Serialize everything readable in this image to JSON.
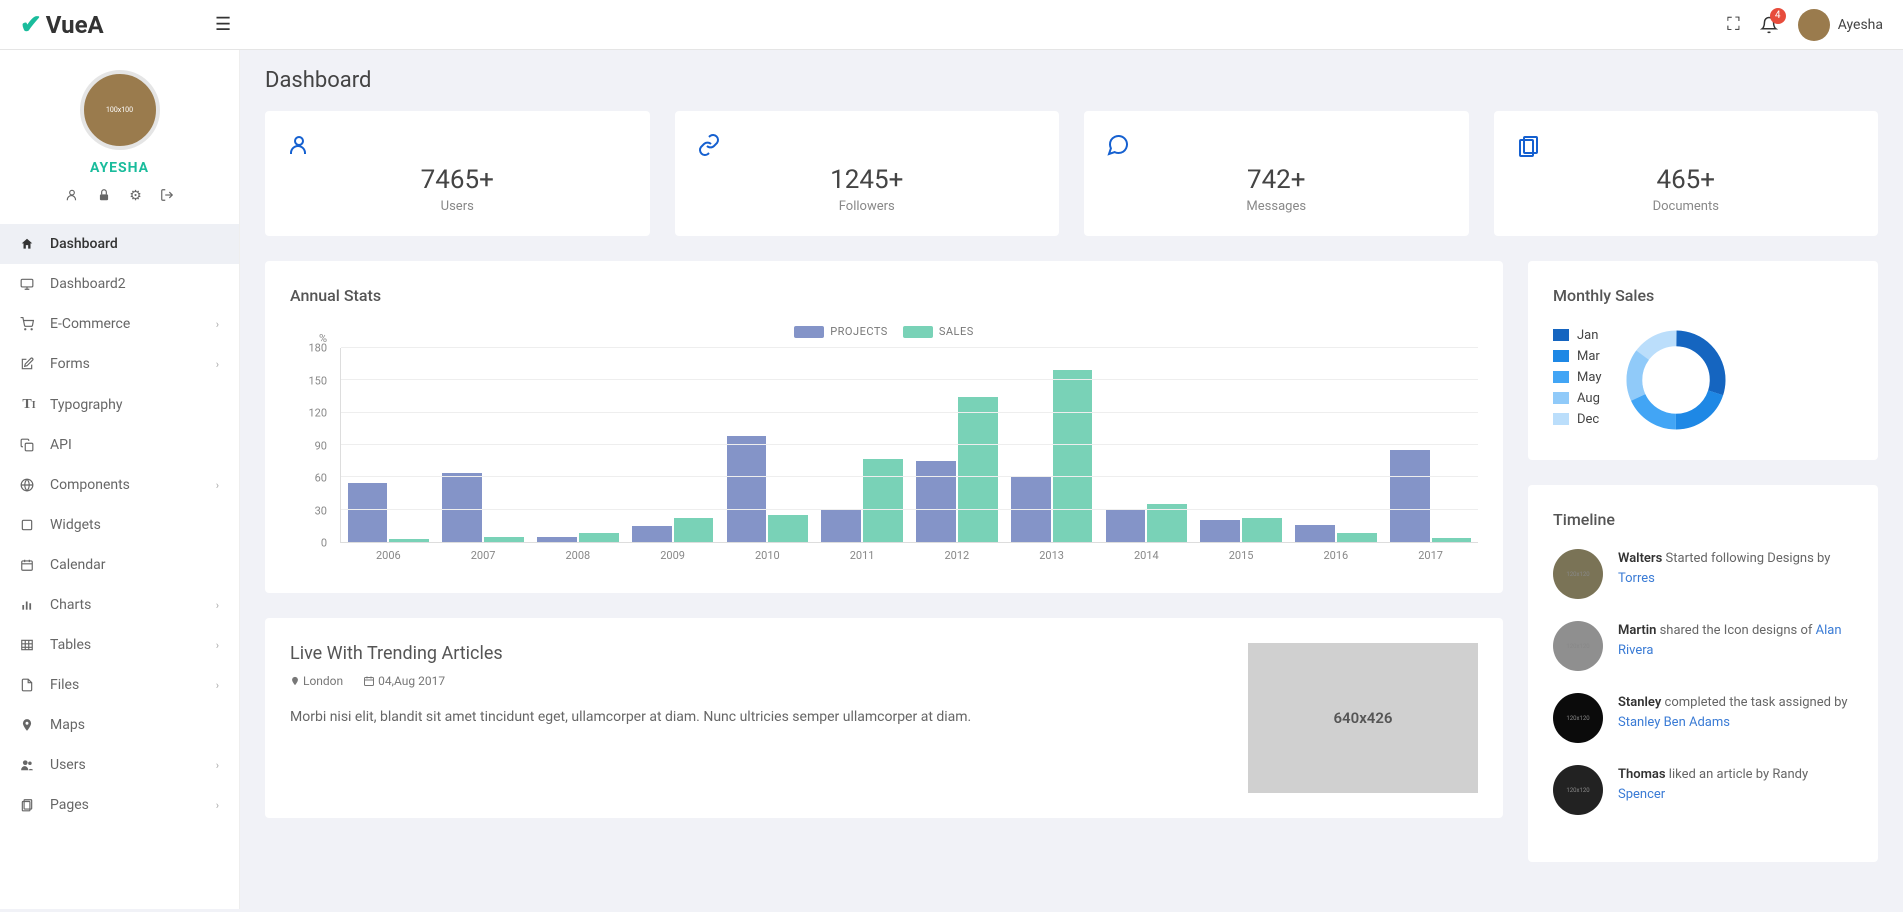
{
  "header": {
    "logo_text": "VueA",
    "notification_count": "4",
    "username": "Ayesha"
  },
  "sidebar": {
    "profile_name": "AYESHA",
    "items": [
      {
        "label": "Dashboard",
        "icon": "home",
        "active": true,
        "expandable": false
      },
      {
        "label": "Dashboard2",
        "icon": "desktop",
        "active": false,
        "expandable": false
      },
      {
        "label": "E-Commerce",
        "icon": "cart",
        "active": false,
        "expandable": true
      },
      {
        "label": "Forms",
        "icon": "edit",
        "active": false,
        "expandable": true
      },
      {
        "label": "Typography",
        "icon": "text",
        "active": false,
        "expandable": false
      },
      {
        "label": "API",
        "icon": "copy",
        "active": false,
        "expandable": false
      },
      {
        "label": "Components",
        "icon": "globe",
        "active": false,
        "expandable": true
      },
      {
        "label": "Widgets",
        "icon": "square",
        "active": false,
        "expandable": false
      },
      {
        "label": "Calendar",
        "icon": "calendar",
        "active": false,
        "expandable": false
      },
      {
        "label": "Charts",
        "icon": "chart",
        "active": false,
        "expandable": true
      },
      {
        "label": "Tables",
        "icon": "table",
        "active": false,
        "expandable": true
      },
      {
        "label": "Files",
        "icon": "file",
        "active": false,
        "expandable": true
      },
      {
        "label": "Maps",
        "icon": "pin",
        "active": false,
        "expandable": false
      },
      {
        "label": "Users",
        "icon": "users",
        "active": false,
        "expandable": true
      },
      {
        "label": "Pages",
        "icon": "pages",
        "active": false,
        "expandable": true
      }
    ]
  },
  "page": {
    "title": "Dashboard"
  },
  "stats": [
    {
      "value": "7465+",
      "label": "Users",
      "icon": "user"
    },
    {
      "value": "1245+",
      "label": "Followers",
      "icon": "link"
    },
    {
      "value": "742+",
      "label": "Messages",
      "icon": "chat"
    },
    {
      "value": "465+",
      "label": "Documents",
      "icon": "docs"
    }
  ],
  "annual_stats_title": "Annual Stats",
  "chart_data": {
    "type": "bar",
    "title": "Annual Stats",
    "ylabel": "%",
    "ylim": [
      0,
      180
    ],
    "y_ticks": [
      0,
      30,
      60,
      90,
      120,
      150,
      180
    ],
    "categories": [
      "2006",
      "2007",
      "2008",
      "2009",
      "2010",
      "2011",
      "2012",
      "2013",
      "2014",
      "2015",
      "2016",
      "2017"
    ],
    "series": [
      {
        "name": "PROJECTS",
        "color": "#8494c8",
        "values": [
          55,
          64,
          5,
          15,
          98,
          30,
          75,
          60,
          30,
          20,
          16,
          85
        ]
      },
      {
        "name": "SALES",
        "color": "#79d2b7",
        "values": [
          3,
          5,
          8,
          22,
          25,
          77,
          135,
          160,
          35,
          22,
          8,
          4
        ]
      }
    ]
  },
  "monthly_sales": {
    "title": "Monthly Sales",
    "legend": [
      {
        "label": "Jan",
        "color": "#1565c0"
      },
      {
        "label": "Mar",
        "color": "#1e88e5"
      },
      {
        "label": "May",
        "color": "#42a5f5"
      },
      {
        "label": "Aug",
        "color": "#90caf9"
      },
      {
        "label": "Dec",
        "color": "#bbdefb"
      }
    ]
  },
  "timeline": {
    "title": "Timeline",
    "items": [
      {
        "name": "Walters",
        "action": " Started following Designs by ",
        "link": "Torres",
        "avatar_bg": "#7a7356"
      },
      {
        "name": "Martin",
        "action": " shared the Icon designs of ",
        "link": "Alan Rivera",
        "avatar_bg": "#8f8f8f"
      },
      {
        "name": "Stanley",
        "action": " completed the task assigned by ",
        "link": "Stanley Ben Adams",
        "avatar_bg": "#0b0b0b"
      },
      {
        "name": "Thomas",
        "action": " liked an article by Randy ",
        "link": "Spencer",
        "avatar_bg": "#222"
      }
    ]
  },
  "article": {
    "title": "Live With Trending Articles",
    "location": "London",
    "date": "04,Aug 2017",
    "body": "Morbi nisi elit, blandit sit amet tincidunt eget, ullamcorper at diam. Nunc ultricies semper ullamcorper at diam.",
    "img_placeholder": "640x426"
  }
}
